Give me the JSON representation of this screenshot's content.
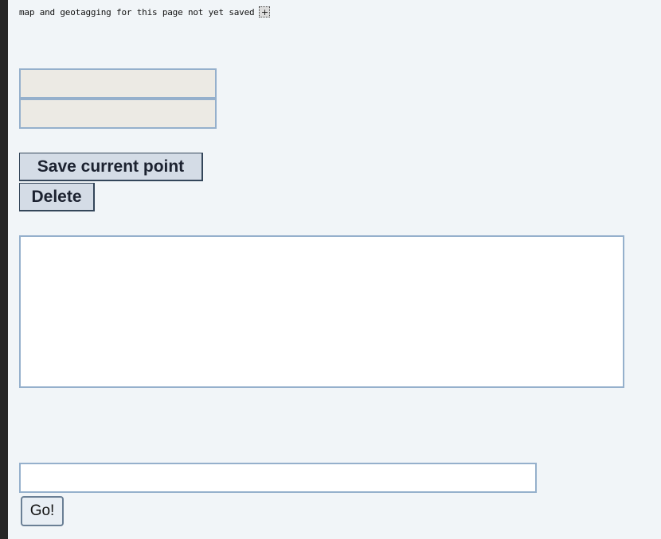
{
  "status": {
    "message": "map and geotagging for this page not yet saved",
    "expand_icon": "plus-box-icon",
    "expand_glyph": "+"
  },
  "coordinates": {
    "latitude_value": "",
    "longitude_value": ""
  },
  "actions": {
    "save_label": "Save current point",
    "delete_label": "Delete"
  },
  "map_area": {
    "value": ""
  },
  "search": {
    "value": "",
    "go_label": "Go!"
  },
  "colors": {
    "panel_background": "#f1f5f8",
    "field_border": "#95b0cc",
    "disabled_field": "#eceae4"
  }
}
